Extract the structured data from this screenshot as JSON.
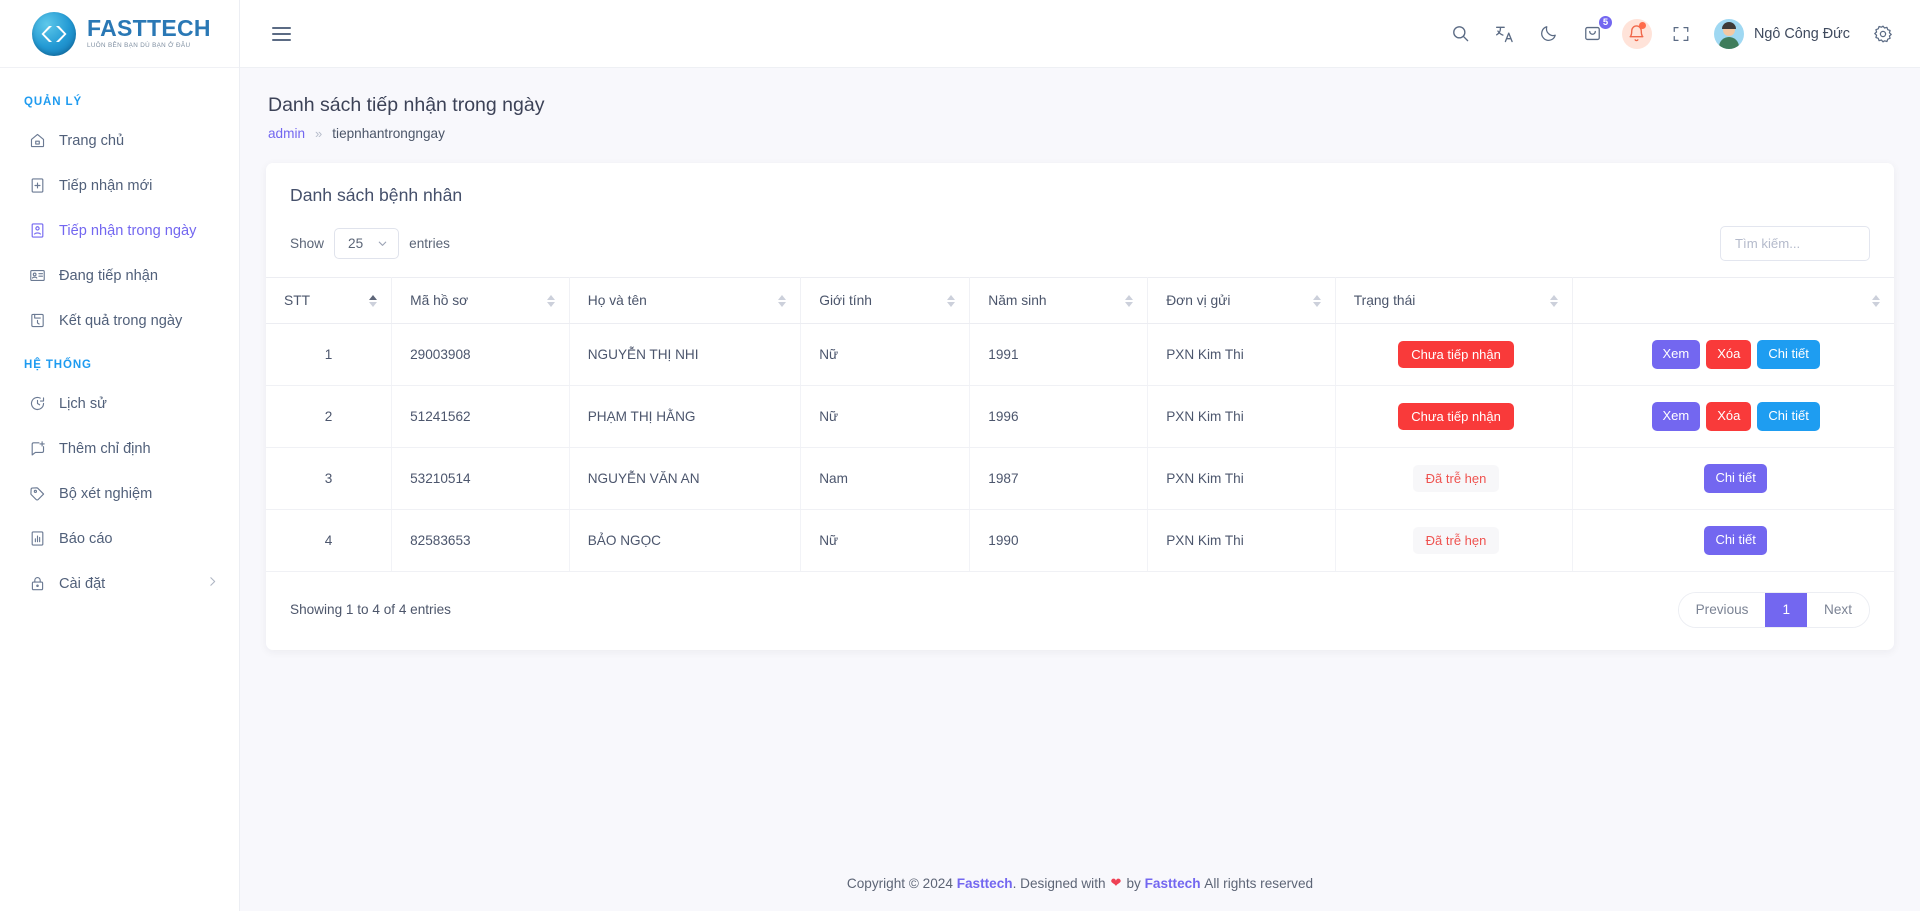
{
  "brand": {
    "name": "FASTTECH",
    "tagline": "LUÔN BÊN BẠN DÙ BẠN Ở ĐÂU"
  },
  "sidebar": {
    "sections": [
      {
        "label": "QUẢN LÝ",
        "items": [
          {
            "label": "Trang chủ",
            "icon": "home-icon",
            "active": false
          },
          {
            "label": "Tiếp nhận mới",
            "icon": "file-plus-icon",
            "active": false
          },
          {
            "label": "Tiếp nhận trong ngày",
            "icon": "id-card-icon",
            "active": true
          },
          {
            "label": "Đang tiếp nhận",
            "icon": "card-list-icon",
            "active": false
          },
          {
            "label": "Kết quả trong ngày",
            "icon": "folder-clock-icon",
            "active": false
          }
        ]
      },
      {
        "label": "HỆ THỐNG",
        "items": [
          {
            "label": "Lịch sử",
            "icon": "clock-icon",
            "active": false
          },
          {
            "label": "Thêm chỉ định",
            "icon": "message-plus-icon",
            "active": false
          },
          {
            "label": "Bộ xét nghiệm",
            "icon": "tag-icon",
            "active": false
          },
          {
            "label": "Báo cáo",
            "icon": "bar-chart-icon",
            "active": false
          },
          {
            "label": "Cài đặt",
            "icon": "lock-icon",
            "active": false,
            "chevron": "chevron-right-icon"
          }
        ]
      }
    ]
  },
  "topbar": {
    "menu_toggle": "hamburger-icon",
    "icons": [
      "search-icon",
      "translate-icon",
      "moon-icon",
      "cart-icon",
      "bell-icon",
      "fullscreen-icon"
    ],
    "cart_badge": "5",
    "user_name": "Ngô Công Đức",
    "settings_icon": "gear-icon"
  },
  "page": {
    "title": "Danh sách tiếp nhận trong ngày",
    "breadcrumb": {
      "root": "admin",
      "separator": "»",
      "current": "tiepnhantrongngay"
    }
  },
  "card": {
    "title": "Danh sách bệnh nhân",
    "show_label": "Show",
    "entries_label": "entries",
    "page_size": "25",
    "search_placeholder": "Tìm kiếm...",
    "columns": [
      {
        "label": "STT",
        "sortable": true,
        "sorted": "asc"
      },
      {
        "label": "Mã hồ sơ",
        "sortable": true,
        "sorted": "none"
      },
      {
        "label": "Họ và tên",
        "sortable": true,
        "sorted": "none"
      },
      {
        "label": "Giới tính",
        "sortable": true,
        "sorted": "none"
      },
      {
        "label": "Năm sinh",
        "sortable": true,
        "sorted": "none"
      },
      {
        "label": "Đơn vị gửi",
        "sortable": true,
        "sorted": "none"
      },
      {
        "label": "Trạng thái",
        "sortable": true,
        "sorted": "none"
      },
      {
        "label": "",
        "sortable": true,
        "sorted": "none"
      }
    ],
    "rows": [
      {
        "stt": "1",
        "ma_ho_so": "29003908",
        "ho_ten": "NGUYỄN THỊ NHI",
        "gioi_tinh": "Nữ",
        "nam_sinh": "1991",
        "don_vi_gui": "PXN Kim Thi",
        "status": {
          "label": "Chưa tiếp nhận",
          "style": "danger"
        },
        "actions": [
          {
            "label": "Xem",
            "style": "purple"
          },
          {
            "label": "Xóa",
            "style": "red"
          },
          {
            "label": "Chi tiết",
            "style": "blue"
          }
        ]
      },
      {
        "stt": "2",
        "ma_ho_so": "51241562",
        "ho_ten": "PHẠM THỊ HẰNG",
        "gioi_tinh": "Nữ",
        "nam_sinh": "1996",
        "don_vi_gui": "PXN Kim Thi",
        "status": {
          "label": "Chưa tiếp nhận",
          "style": "danger"
        },
        "actions": [
          {
            "label": "Xem",
            "style": "purple"
          },
          {
            "label": "Xóa",
            "style": "red"
          },
          {
            "label": "Chi tiết",
            "style": "blue"
          }
        ]
      },
      {
        "stt": "3",
        "ma_ho_so": "53210514",
        "ho_ten": "NGUYỄN VĂN AN",
        "gioi_tinh": "Nam",
        "nam_sinh": "1987",
        "don_vi_gui": "PXN Kim Thi",
        "status": {
          "label": "Đã trễ hẹn",
          "style": "late"
        },
        "actions": [
          {
            "label": "Chi tiết",
            "style": "purple"
          }
        ]
      },
      {
        "stt": "4",
        "ma_ho_so": "82583653",
        "ho_ten": "BẢO NGỌC",
        "gioi_tinh": "Nữ",
        "nam_sinh": "1990",
        "don_vi_gui": "PXN Kim Thi",
        "status": {
          "label": "Đã trễ hẹn",
          "style": "late"
        },
        "actions": [
          {
            "label": "Chi tiết",
            "style": "purple"
          }
        ]
      }
    ],
    "showing_text": "Showing 1 to 4 of 4 entries",
    "pagination": {
      "previous": "Previous",
      "pages": [
        "1"
      ],
      "next": "Next",
      "active": "1"
    }
  },
  "footer": {
    "copyright": "Copyright © 2024",
    "brand1": "Fasttech",
    "designed": ". Designed with",
    "heart": "❤",
    "by": "by",
    "brand2": "Fasttech",
    "rights": "All rights reserved"
  },
  "colors": {
    "primary": "#7367f0",
    "danger": "#f93a3a",
    "info": "#1e9df1",
    "section": "#1e9bf0"
  }
}
